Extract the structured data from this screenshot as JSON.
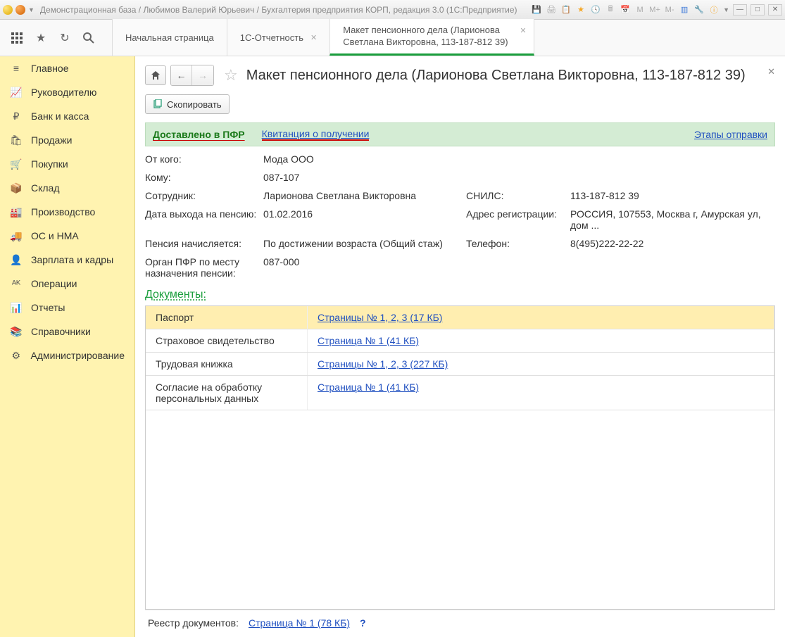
{
  "titlebar": {
    "text": "Демонстрационная база / Любимов Валерий Юрьевич / Бухгалтерия предприятия КОРП, редакция 3.0  (1С:Предприятие)"
  },
  "tabs": {
    "t0": "Начальная страница",
    "t1": "1С-Отчетность",
    "t2a": "Макет пенсионного дела (Ларионова",
    "t2b": "Светлана Викторовна, 113-187-812 39)"
  },
  "sidebar": {
    "items": [
      {
        "icon": "≡",
        "label": "Главное"
      },
      {
        "icon": "↗",
        "label": "Руководителю"
      },
      {
        "icon": "₽",
        "label": "Банк и касса"
      },
      {
        "icon": "🛍",
        "label": "Продажи"
      },
      {
        "icon": "🛒",
        "label": "Покупки"
      },
      {
        "icon": "📦",
        "label": "Склад"
      },
      {
        "icon": "🏭",
        "label": "Производство"
      },
      {
        "icon": "🚚",
        "label": "ОС и НМА"
      },
      {
        "icon": "👤",
        "label": "Зарплата и кадры"
      },
      {
        "icon": "↕",
        "label": "Операции"
      },
      {
        "icon": "📊",
        "label": "Отчеты"
      },
      {
        "icon": "📚",
        "label": "Справочники"
      },
      {
        "icon": "⚙",
        "label": "Администрирование"
      }
    ]
  },
  "page": {
    "title": "Макет пенсионного дела (Ларионова Светлана Викторовна, 113-187-812 39)",
    "copy": "Скопировать",
    "status": {
      "text": "Доставлено в ПФР",
      "link": "Квитанция о получении",
      "right": "Этапы отправки"
    },
    "fields": {
      "from_l": "От кого:",
      "from_v": "Мода ООО",
      "to_l": "Кому:",
      "to_v": "087-107",
      "emp_l": "Сотрудник:",
      "emp_v": "Ларионова Светлана Викторовна",
      "snils_l": "СНИЛС:",
      "snils_v": "113-187-812 39",
      "date_l": "Дата выхода на пенсию:",
      "date_v": "01.02.2016",
      "addr_l": "Адрес регистрации:",
      "addr_v": "РОССИЯ, 107553, Москва г, Амурская ул, дом ...",
      "pen_l": "Пенсия начисляется:",
      "pen_v": "По достижении возраста (Общий стаж)",
      "tel_l": "Телефон:",
      "tel_v": "8(495)222-22-22",
      "org_l": "Орган ПФР по месту назначения пенсии:",
      "org_v": "087-000"
    },
    "docsection": "Документы:",
    "docs": [
      {
        "name": "Паспорт",
        "link": "Страницы № 1, 2, 3 (17 КБ)"
      },
      {
        "name": "Страховое свидетельство",
        "link": "Страница № 1 (41 КБ)"
      },
      {
        "name": "Трудовая книжка",
        "link": "Страницы № 1, 2, 3 (227 КБ)"
      },
      {
        "name": "Согласие на обработку персональных данных",
        "link": "Страница № 1 (41 КБ)"
      }
    ],
    "footer": {
      "label": "Реестр документов:",
      "link": "Страница № 1 (78 КБ)",
      "help": "?"
    }
  }
}
